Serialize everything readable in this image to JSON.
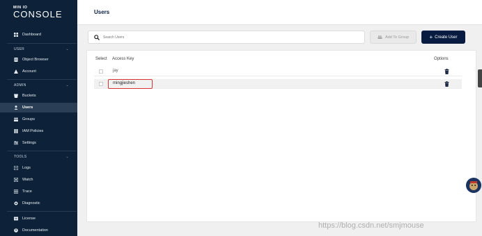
{
  "logo": {
    "top": "MIN IO",
    "main": "CONSOLE"
  },
  "sidebar": {
    "dashboard": "Dashboard",
    "user_section": "USER",
    "user_items": [
      "Object Browser",
      "Account"
    ],
    "admin_section": "ADMIN",
    "admin_items": [
      "Buckets",
      "Users",
      "Groups",
      "IAM Policies",
      "Settings"
    ],
    "tools_section": "TOOLS",
    "tools_items": [
      "Logs",
      "Watch",
      "Trace",
      "Diagnostic"
    ],
    "bottom_items": [
      "License",
      "Documentation"
    ],
    "active_item": "Users"
  },
  "header": {
    "title": "Users"
  },
  "toolbar": {
    "search_placeholder": "Search Users",
    "add_to_group_label": "Add To Group",
    "create_user_label": "Create User"
  },
  "table": {
    "columns": {
      "select": "Select",
      "access_key": "Access Key",
      "options": "Options"
    },
    "rows": [
      {
        "access_key": "jay",
        "selected": false
      },
      {
        "access_key": "mingjieshen",
        "selected": true
      }
    ]
  },
  "watermark": "https://blog.csdn.net/smjmouse",
  "colors": {
    "sidebar_bg": "#0d2238",
    "accent": "#081c42",
    "highlight": "#d93030"
  }
}
